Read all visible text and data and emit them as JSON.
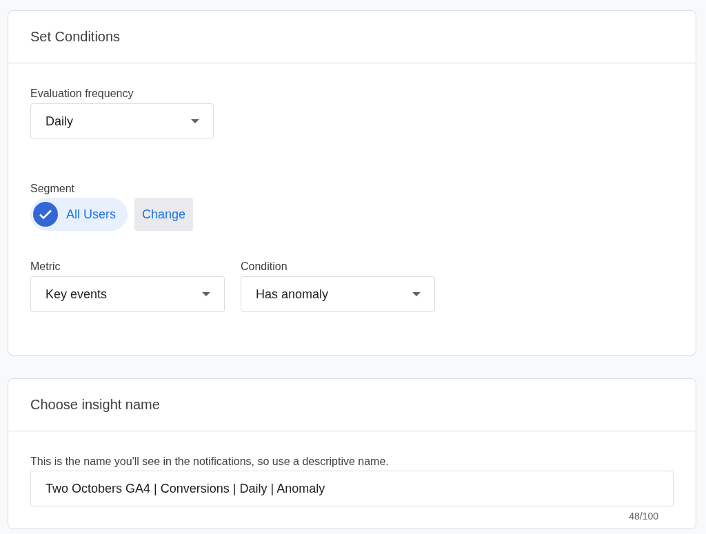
{
  "conditions_card": {
    "title": "Set Conditions",
    "evaluation_frequency": {
      "label": "Evaluation frequency",
      "value": "Daily"
    },
    "segment": {
      "label": "Segment",
      "chip": {
        "label": "All Users",
        "checked": true
      },
      "change_button": "Change"
    },
    "metric": {
      "label": "Metric",
      "value": "Key events"
    },
    "condition": {
      "label": "Condition",
      "value": "Has anomaly"
    }
  },
  "name_card": {
    "title": "Choose insight name",
    "description": "This is the name you'll see in the notifications, so use a descriptive name.",
    "name_field": {
      "value": "Two Octobers GA4 | Conversions | Daily | Anomaly",
      "counter": "48/100"
    }
  }
}
